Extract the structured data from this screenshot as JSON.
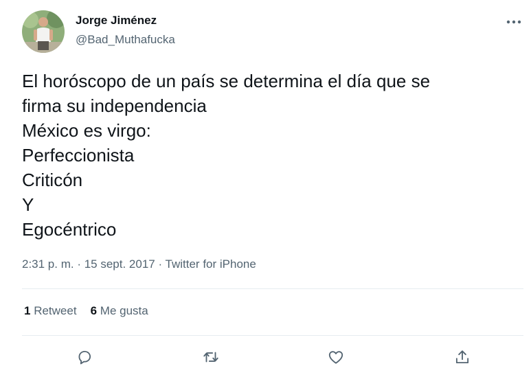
{
  "author": {
    "name": "Jorge Jiménez",
    "handle": "@Bad_Muthafucka"
  },
  "tweet": {
    "lines": [
      "El horóscopo de un país se determina el día que se",
      "firma su independencia",
      "México es virgo:",
      "Perfeccionista",
      "Criticón",
      "Y",
      "Egocéntrico"
    ],
    "timestamp": "2:31 p. m. · 15 sept. 2017 · Twitter for iPhone"
  },
  "stats": {
    "retweets_count": "1",
    "retweets_label": "Retweet",
    "likes_count": "6",
    "likes_label": "Me gusta"
  },
  "actions": {
    "icons": [
      "reply-icon",
      "retweet-icon",
      "like-icon",
      "share-icon"
    ],
    "color": "#536471"
  },
  "colors": {
    "text": "#0f1419",
    "secondary": "#536471",
    "divider": "#e6ecf0"
  }
}
